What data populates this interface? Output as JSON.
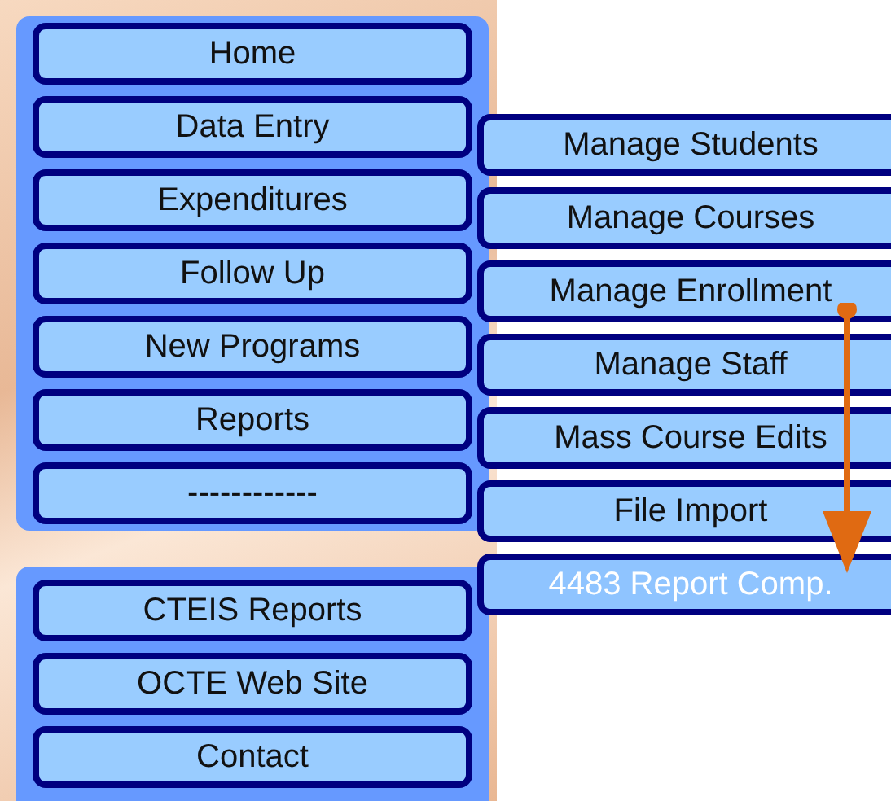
{
  "main_menu": [
    {
      "label": "Home"
    },
    {
      "label": "Data Entry"
    },
    {
      "label": "Expenditures"
    },
    {
      "label": "Follow Up"
    },
    {
      "label": "New Programs"
    },
    {
      "label": "Reports"
    },
    {
      "label": "------------"
    }
  ],
  "submenu": [
    {
      "label": "Manage Students",
      "selected": false
    },
    {
      "label": "Manage Courses",
      "selected": false
    },
    {
      "label": "Manage Enrollment",
      "selected": false
    },
    {
      "label": "Manage Staff",
      "selected": false
    },
    {
      "label": "Mass Course Edits",
      "selected": false
    },
    {
      "label": "File Import",
      "selected": false
    },
    {
      "label": "4483 Report Comp.",
      "selected": true
    }
  ],
  "links_menu": [
    {
      "label": "CTEIS Reports"
    },
    {
      "label": "OCTE Web Site"
    },
    {
      "label": "Contact"
    }
  ]
}
